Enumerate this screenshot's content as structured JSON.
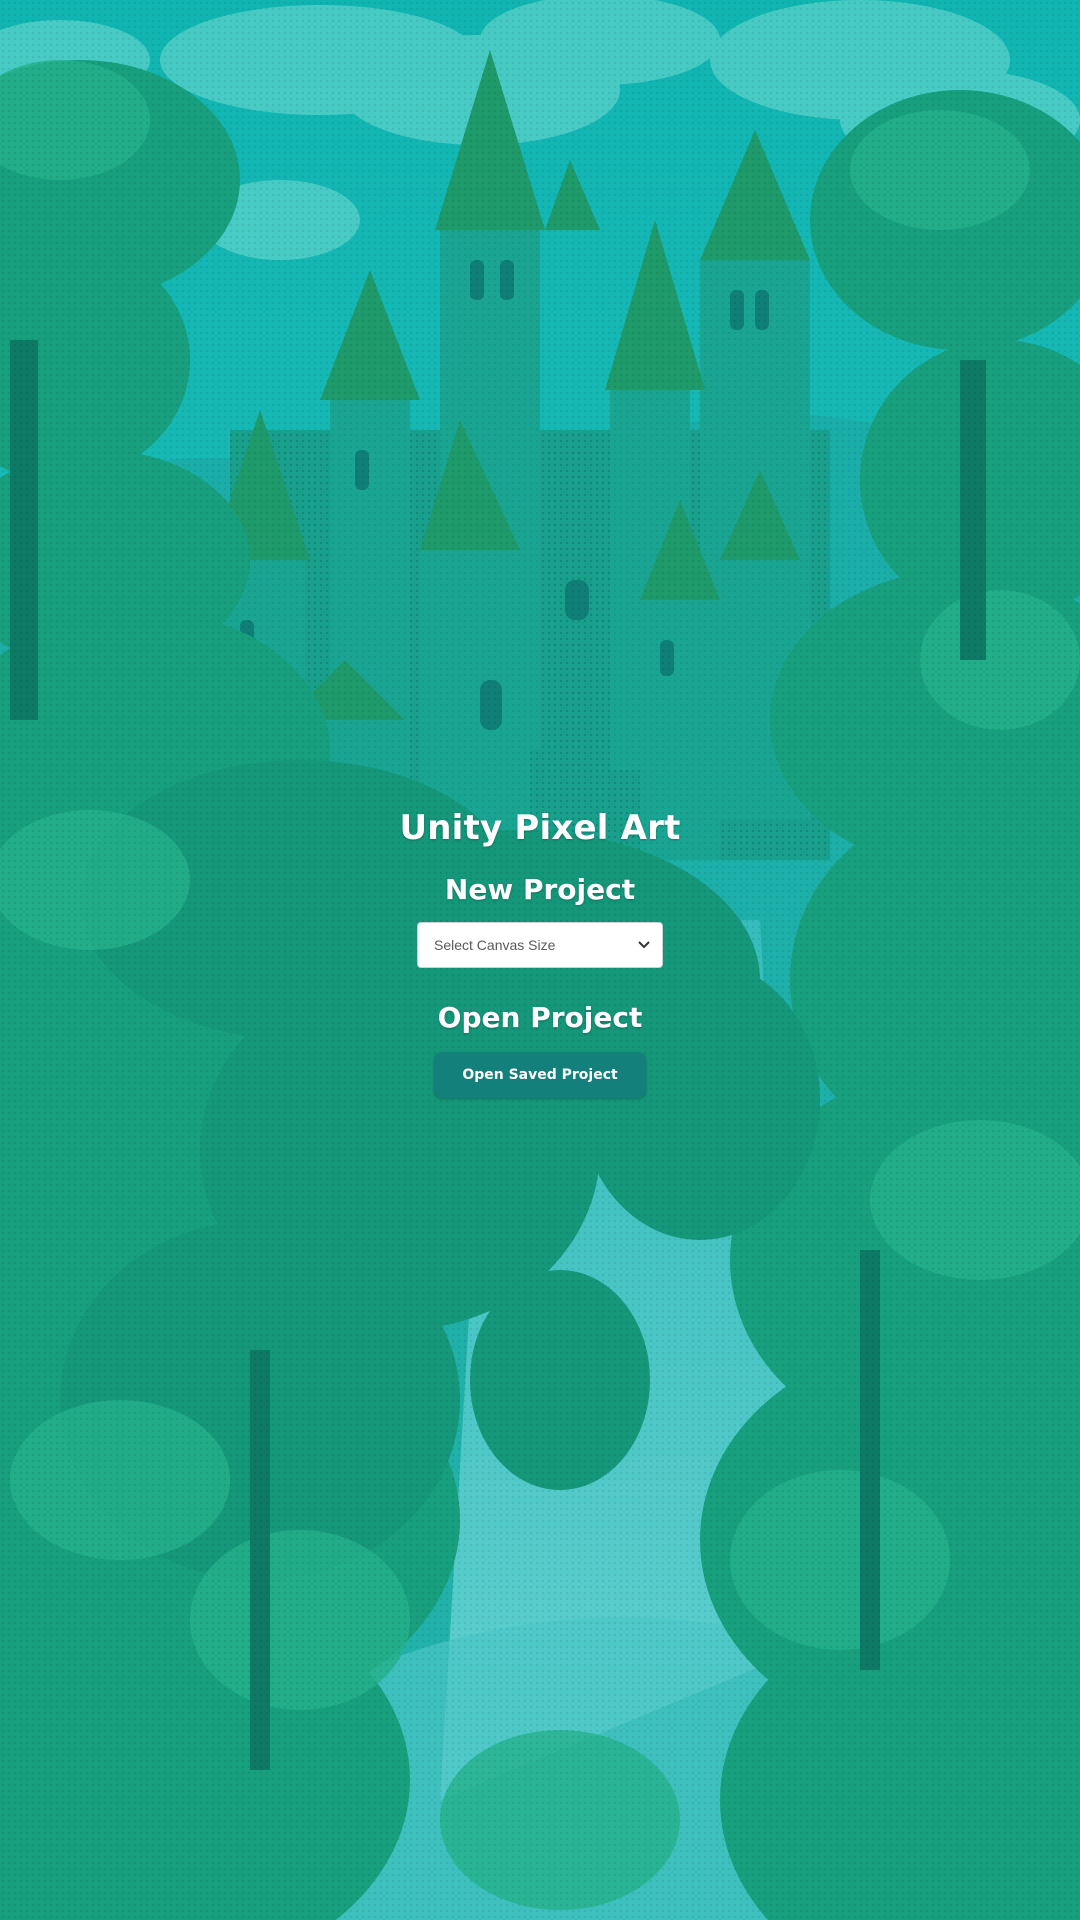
{
  "app": {
    "title": "Unity Pixel Art"
  },
  "new_project": {
    "heading": "New Project",
    "canvas_select": {
      "placeholder": "Select Canvas Size",
      "icon": "chevron-down-icon"
    }
  },
  "open_project": {
    "heading": "Open Project",
    "button_label": "Open Saved Project"
  },
  "theme": {
    "sky": "#1fb9b4",
    "forest_dark": "#0f8a74",
    "forest_mid": "#1aa27f",
    "forest_light": "#2bb98d",
    "castle": "#19a389",
    "castle_roof": "#1f9a6d",
    "waterfall": "#4dc7c6",
    "button": "#13807c",
    "text": "#ffffff"
  }
}
